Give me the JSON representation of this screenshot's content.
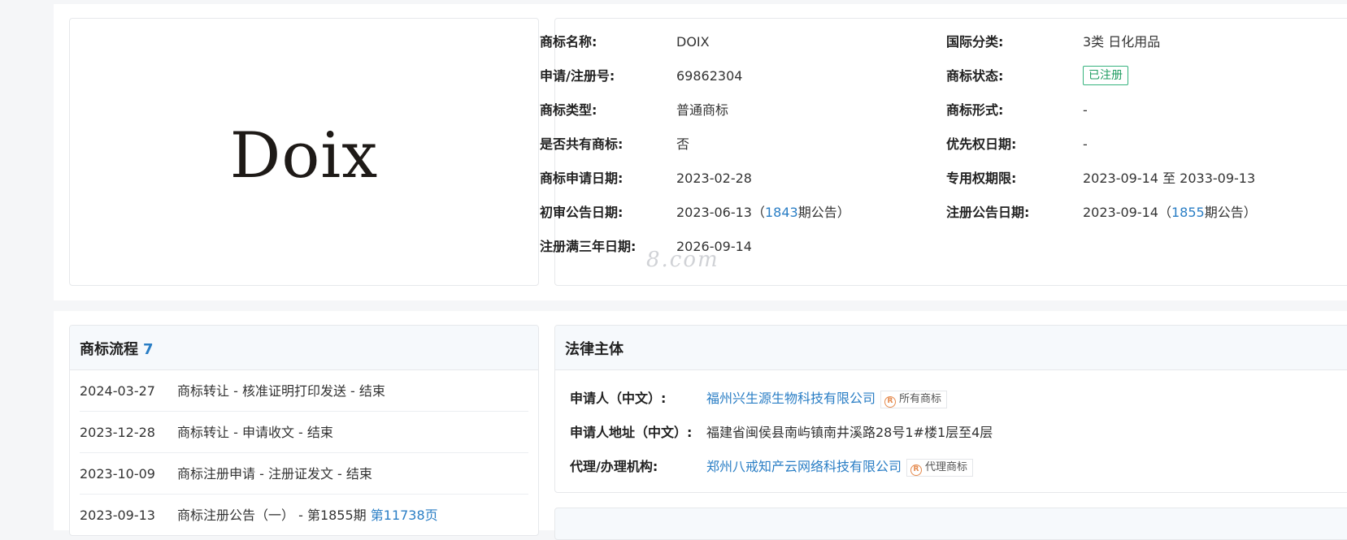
{
  "logo": {
    "text": "Doix"
  },
  "details": {
    "name_label": "商标名称:",
    "name_value": "DOIX",
    "class_label": "国际分类:",
    "class_value": "3类 日化用品",
    "regno_label": "申请/注册号:",
    "regno_value": "69862304",
    "status_label": "商标状态:",
    "status_value": "已注册",
    "type_label": "商标类型:",
    "type_value": "普通商标",
    "form_label": "商标形式:",
    "form_value": "-",
    "shared_label": "是否共有商标:",
    "shared_value": "否",
    "priority_label": "优先权日期:",
    "priority_value": "-",
    "appdate_label": "商标申请日期:",
    "appdate_value": "2023-02-28",
    "exclusive_label": "专用权期限:",
    "exclusive_value": "2023-09-14 至 2033-09-13",
    "prelim_label": "初审公告日期:",
    "prelim_date": "2023-06-13（",
    "prelim_issue": "1843",
    "prelim_suffix": "期公告）",
    "regpub_label": "注册公告日期:",
    "regpub_date": "2023-09-14（",
    "regpub_issue": "1855",
    "regpub_suffix": "期公告）",
    "three_year_label": "注册满三年日期:",
    "three_year_value": "2026-09-14"
  },
  "watermark": "8.com",
  "flow": {
    "title": "商标流程",
    "count": "7",
    "rows": [
      {
        "date": "2024-03-27",
        "desc": "商标转让 - 核准证明打印发送 - 结束"
      },
      {
        "date": "2023-12-28",
        "desc": "商标转让 - 申请收文 - 结束"
      },
      {
        "date": "2023-10-09",
        "desc": "商标注册申请 - 注册证发文 - 结束"
      },
      {
        "date": "2023-09-13",
        "desc": "商标注册公告（一） - 第1855期",
        "link": "第11738页"
      }
    ]
  },
  "legal": {
    "title": "法律主体",
    "applicant_label": "申请人（中文）:",
    "applicant_value": "福州兴生源生物科技有限公司",
    "applicant_tag": "所有商标",
    "address_label": "申请人地址（中文）:",
    "address_value": "福建省闽侯县南屿镇南井溪路28号1#楼1层至4层",
    "agent_label": "代理/办理机构:",
    "agent_value": "郑州八戒知产云网络科技有限公司",
    "agent_tag": "代理商标",
    "r_icon": "R"
  },
  "colors": {
    "accent_blue": "#2a7ec5",
    "status_green": "#1f9c61",
    "tag_orange": "#e58a4e"
  }
}
